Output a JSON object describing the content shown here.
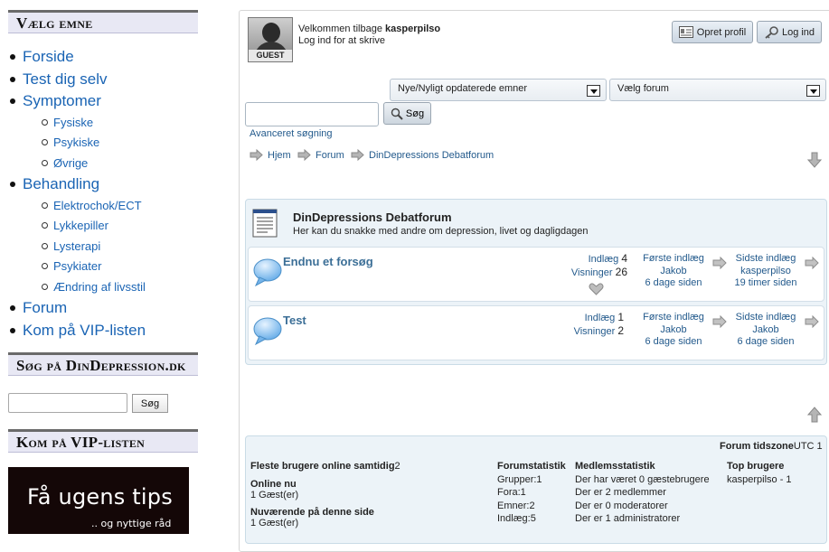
{
  "sidebar": {
    "topic_heading": "Vælg emne",
    "nav": [
      {
        "label": "Forside"
      },
      {
        "label": "Test dig selv"
      },
      {
        "label": "Symptomer",
        "children": [
          "Fysiske",
          "Psykiske",
          "Øvrige"
        ]
      },
      {
        "label": "Behandling",
        "children": [
          "Elektrochok/ECT",
          "Lykkepiller",
          "Lysterapi",
          "Psykiater",
          "Ændring af livsstil"
        ]
      },
      {
        "label": "Forum"
      },
      {
        "label": "Kom på VIP-listen"
      }
    ],
    "search_heading": "Søg på DinDepression.dk",
    "search_button": "Søg",
    "search_value": "",
    "vip_heading": "Kom på VIP-listen",
    "banner_big": "Få ugens tips",
    "banner_small": ".. og nyttige råd"
  },
  "header": {
    "avatar_label": "GUEST",
    "welcome_prefix": "Velkommen tilbage ",
    "username": "kasperpilso",
    "login_hint": "Log ind for at skrive",
    "create_profile": "Opret profil",
    "login": "Log ind"
  },
  "toolbar": {
    "topics_select": "Nye/Nyligt opdaterede emner",
    "forum_select": "Vælg forum",
    "search_value": "",
    "search_button": "Søg",
    "advanced_search": "Avanceret søgning"
  },
  "breadcrumb": [
    "Hjem",
    "Forum",
    "DinDepressions Debatforum"
  ],
  "forum": {
    "title": "DinDepressions Debatforum",
    "description": "Her kan du snakke med andre om depression, livet og dagligdagen",
    "topics": [
      {
        "title": "Endnu et forsøg",
        "posts_label": "Indlæg",
        "posts": "4",
        "views_label": "Visninger",
        "views": "26",
        "first_label": "Første indlæg",
        "first_author": "Jakob",
        "first_time": "6 dage siden",
        "last_label": "Sidste indlæg",
        "last_author": "kasperpilso",
        "last_time": "19 timer siden"
      },
      {
        "title": "Test",
        "posts_label": "Indlæg",
        "posts": "1",
        "views_label": "Visninger",
        "views": "2",
        "first_label": "Første indlæg",
        "first_author": "Jakob",
        "first_time": "6 dage siden",
        "last_label": "Sidste indlæg",
        "last_author": "Jakob",
        "last_time": "6 dage siden"
      }
    ]
  },
  "stats": {
    "timezone_label": "Forum tidszone",
    "timezone_value": "UTC 1",
    "most_online_label": "Fleste brugere online samtidig",
    "most_online_value": "2",
    "online_now_label": "Online nu",
    "online_now_value": "1 Gæst(er)",
    "on_page_label": "Nuværende på denne side",
    "on_page_value": "1 Gæst(er)",
    "forum_stats_label": "Forumstatistik",
    "forum_stats": [
      "Grupper:1",
      "Fora:1",
      "Emner:2",
      "Indlæg:5"
    ],
    "member_stats_label": "Medlemsstatistik",
    "member_stats": [
      "Der har været 0 gæstebrugere",
      "Der er 2 medlemmer",
      "Der er 0 moderatorer",
      "Der er 1 administratorer"
    ],
    "top_users_label": "Top brugere",
    "top_users": [
      "kasperpilso - 1"
    ]
  }
}
